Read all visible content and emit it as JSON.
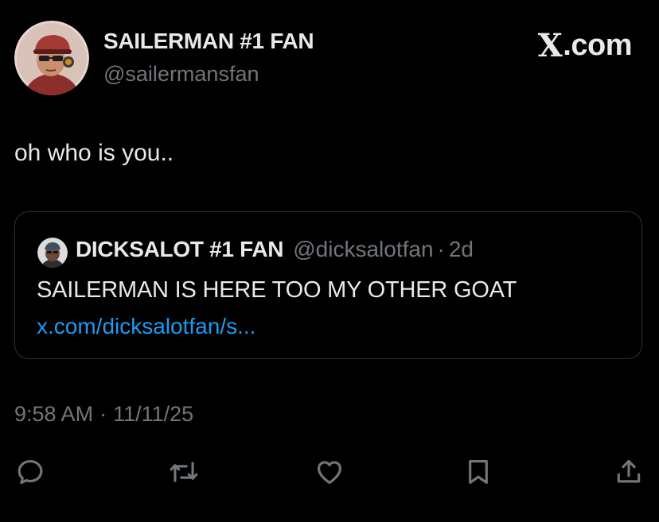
{
  "author": {
    "name": "SAILERMAN #1 FAN",
    "handle": "@sailermansfan"
  },
  "brand": {
    "glyph": "X",
    "suffix": ".com"
  },
  "tweet": {
    "text": "oh who is you.."
  },
  "quote": {
    "name": "DICKSALOT #1 FAN",
    "handle": "@dicksalotfan",
    "separator": "·",
    "time": "2d",
    "text": "SAILERMAN IS HERE TOO MY OTHER GOAT",
    "link": "x.com/dicksalotfan/s..."
  },
  "meta": {
    "time": "9:58 AM",
    "separator": "·",
    "date": "11/11/25"
  },
  "actions": {
    "reply": "reply-icon",
    "retweet": "retweet-icon",
    "like": "heart-icon",
    "bookmark": "bookmark-icon",
    "share": "share-icon"
  },
  "colors": {
    "background": "#000000",
    "text": "#e7e9ea",
    "secondary": "#71767b",
    "link": "#1d9bf0",
    "border": "#2f3336"
  }
}
